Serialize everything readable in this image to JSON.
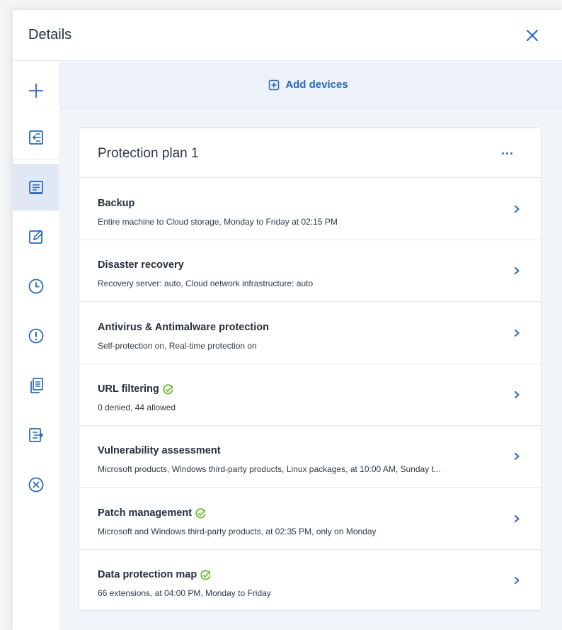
{
  "header": {
    "title": "Details"
  },
  "sidebar": {
    "items": [
      {
        "icon": "plus-icon"
      },
      {
        "icon": "import-icon"
      },
      {
        "icon": "protection-plan-icon",
        "active": true
      },
      {
        "icon": "edit-icon"
      },
      {
        "icon": "clock-icon"
      },
      {
        "icon": "alert-icon"
      },
      {
        "icon": "copy-icon"
      },
      {
        "icon": "export-icon"
      },
      {
        "icon": "revoke-icon"
      }
    ]
  },
  "content": {
    "add_devices_label": "Add devices",
    "plan": {
      "title": "Protection plan 1",
      "more_label": "...",
      "modules": [
        {
          "title": "Backup",
          "description": "Entire machine to Cloud storage, Monday to Friday at 02:15 PM",
          "status_ok": false
        },
        {
          "title": "Disaster recovery",
          "description": "Recovery server: auto, Cloud network infrastructure: auto",
          "status_ok": false
        },
        {
          "title": "Antivirus & Antimalware protection",
          "description": "Self-protection on, Real-time protection on",
          "status_ok": false
        },
        {
          "title": "URL filtering",
          "description": "0 denied, 44 allowed",
          "status_ok": true
        },
        {
          "title": "Vulnerability assessment",
          "description": "Microsoft products, Windows third-party products, Linux packages, at 10:00 AM, Sunday t...",
          "status_ok": false
        },
        {
          "title": "Patch management",
          "description": "Microsoft and Windows third-party products, at 02:35 PM, only on Monday",
          "status_ok": true
        },
        {
          "title": "Data protection map",
          "description": "66 extensions, at 04:00 PM, Monday to Friday",
          "status_ok": true
        }
      ]
    }
  },
  "colors": {
    "accent": "#2668c5",
    "ok_green": "#6dbf2e",
    "active_bg": "#dfe8f3"
  }
}
